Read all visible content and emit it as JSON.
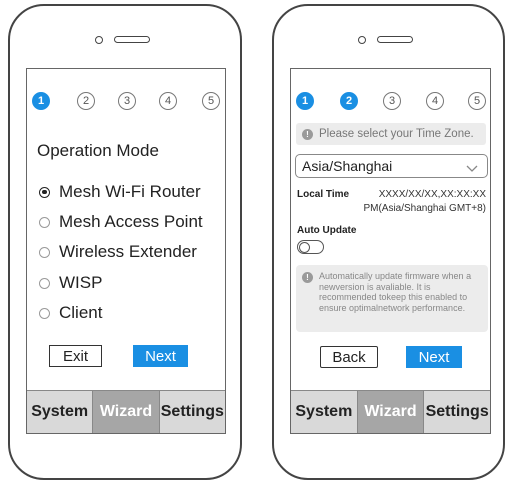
{
  "left": {
    "steps": [
      "1",
      "2",
      "3",
      "4",
      "5"
    ],
    "active_step": 1,
    "title": "Operation Mode",
    "modes": [
      {
        "label": "Mesh Wi-Fi Router",
        "checked": true
      },
      {
        "label": "Mesh Access Point",
        "checked": false
      },
      {
        "label": "Wireless Extender",
        "checked": false
      },
      {
        "label": "WISP",
        "checked": false
      },
      {
        "label": "Client",
        "checked": false
      }
    ],
    "exit_label": "Exit",
    "next_label": "Next"
  },
  "right": {
    "steps": [
      "1",
      "2",
      "3",
      "4",
      "5"
    ],
    "active_step": 2,
    "tz_notice": "Please select your Time Zone.",
    "tz_value": "Asia/Shanghai",
    "local_time_label": "Local Time",
    "local_time_value_line1": "XXXX/XX/XX,XX:XX:XX",
    "local_time_value_line2": "PM(Asia/Shanghai GMT+8)",
    "auto_update_label": "Auto Update",
    "auto_update_on": false,
    "auto_update_info": "Automatically update firmware when a newversion is avaliable. It is recommended tokeep this enabled to ensure optimalnetwork performance.",
    "back_label": "Back",
    "next_label": "Next"
  },
  "tabs": {
    "system": "System",
    "wizard": "Wizard",
    "settings": "Settings",
    "active": "wizard"
  },
  "colors": {
    "accent": "#1a8fe3",
    "tab_active": "#a6a6a6",
    "tab_bg": "#d9d9d9"
  }
}
